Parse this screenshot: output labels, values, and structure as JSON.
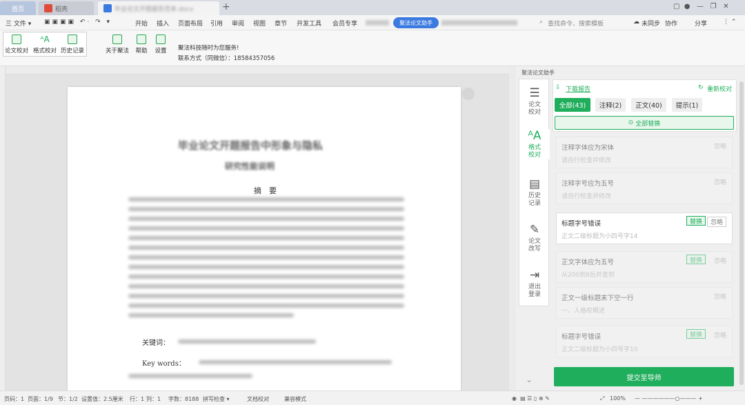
{
  "tabs": {
    "home": "首页",
    "wps": "稻壳",
    "doc": "毕业论文开题报告范本.docx"
  },
  "menu": {
    "file": "三 文件 ▾",
    "items": [
      "开始",
      "插入",
      "页面布局",
      "引用",
      "审阅",
      "视图",
      "章节",
      "开发工具",
      "会员专享"
    ],
    "assistant": "聚法论文助手",
    "search": "查找命令、搜索模板",
    "sync": "未同步",
    "collab": "协作",
    "share": "分享"
  },
  "toolbar": {
    "check": "论文校对",
    "format": "格式校对",
    "history": "历史记录",
    "about": "关于聚法",
    "help": "帮助",
    "settings": "设置",
    "service_line": "聚法科技随时为您服务!",
    "contact_label": "联系方式（同微信）：",
    "contact_phone": "18584357056"
  },
  "document": {
    "title1": "毕业论文开题报告中形象与隐私",
    "title2": "研究性能说明",
    "abstract_heading": "摘　要",
    "keywords_cn": "关键词：",
    "keywords_en": "Key words："
  },
  "panel": {
    "title": "聚法论文助手",
    "nav": [
      {
        "label": "论文\n校对",
        "icon": "check-list-icon"
      },
      {
        "label": "格式\n校对",
        "icon": "format-icon"
      },
      {
        "label": "历史\n记录",
        "icon": "clipboard-icon"
      },
      {
        "label": "论文\n改写",
        "icon": "edit-icon"
      },
      {
        "label": "退出\n登录",
        "icon": "logout-icon"
      }
    ],
    "download": "下载报告",
    "recheck": "重新校对",
    "filters": {
      "all": "全部(43)",
      "note": "注释(2)",
      "body": "正文(40)",
      "tip": "提示(1)"
    },
    "replace_all": "全部替换",
    "cards": [
      {
        "title": "注释字体应为宋体",
        "desc": "请自行检查并修改",
        "replace": "",
        "ignore": "忽略"
      },
      {
        "title": "注释字号应为五号",
        "desc": "请自行检查并修改",
        "replace": "",
        "ignore": "忽略"
      },
      {
        "title": "标题字号错误",
        "desc": "正文二级标题为小四号字14",
        "replace": "替换",
        "ignore": "忽略"
      },
      {
        "title": "正文字体应为五号",
        "desc": "从200到8后并查到",
        "replace": "替换",
        "ignore": "忽略"
      },
      {
        "title": "正文一级标题末下空一行",
        "desc": "一、人格权概述",
        "replace": "",
        "ignore": "忽略"
      },
      {
        "title": "标题字号错误",
        "desc": "正文二级标题为小四号字10",
        "replace": "替换",
        "ignore": "忽略"
      }
    ],
    "submit": "提交至导师"
  },
  "status": {
    "page": "页码：1",
    "pages": "页面：1/9",
    "section": "节：1/2",
    "setting": "设置值：2.5厘米",
    "row": "行：1",
    "col": "列：1",
    "words": "字数：8188",
    "spell": "拼写检查 ▾",
    "proof": "文档校对",
    "mode": "兼容模式",
    "zoom": "100%"
  },
  "colors": {
    "accent": "#1fae5b",
    "assistant": "#3b7ae0"
  }
}
